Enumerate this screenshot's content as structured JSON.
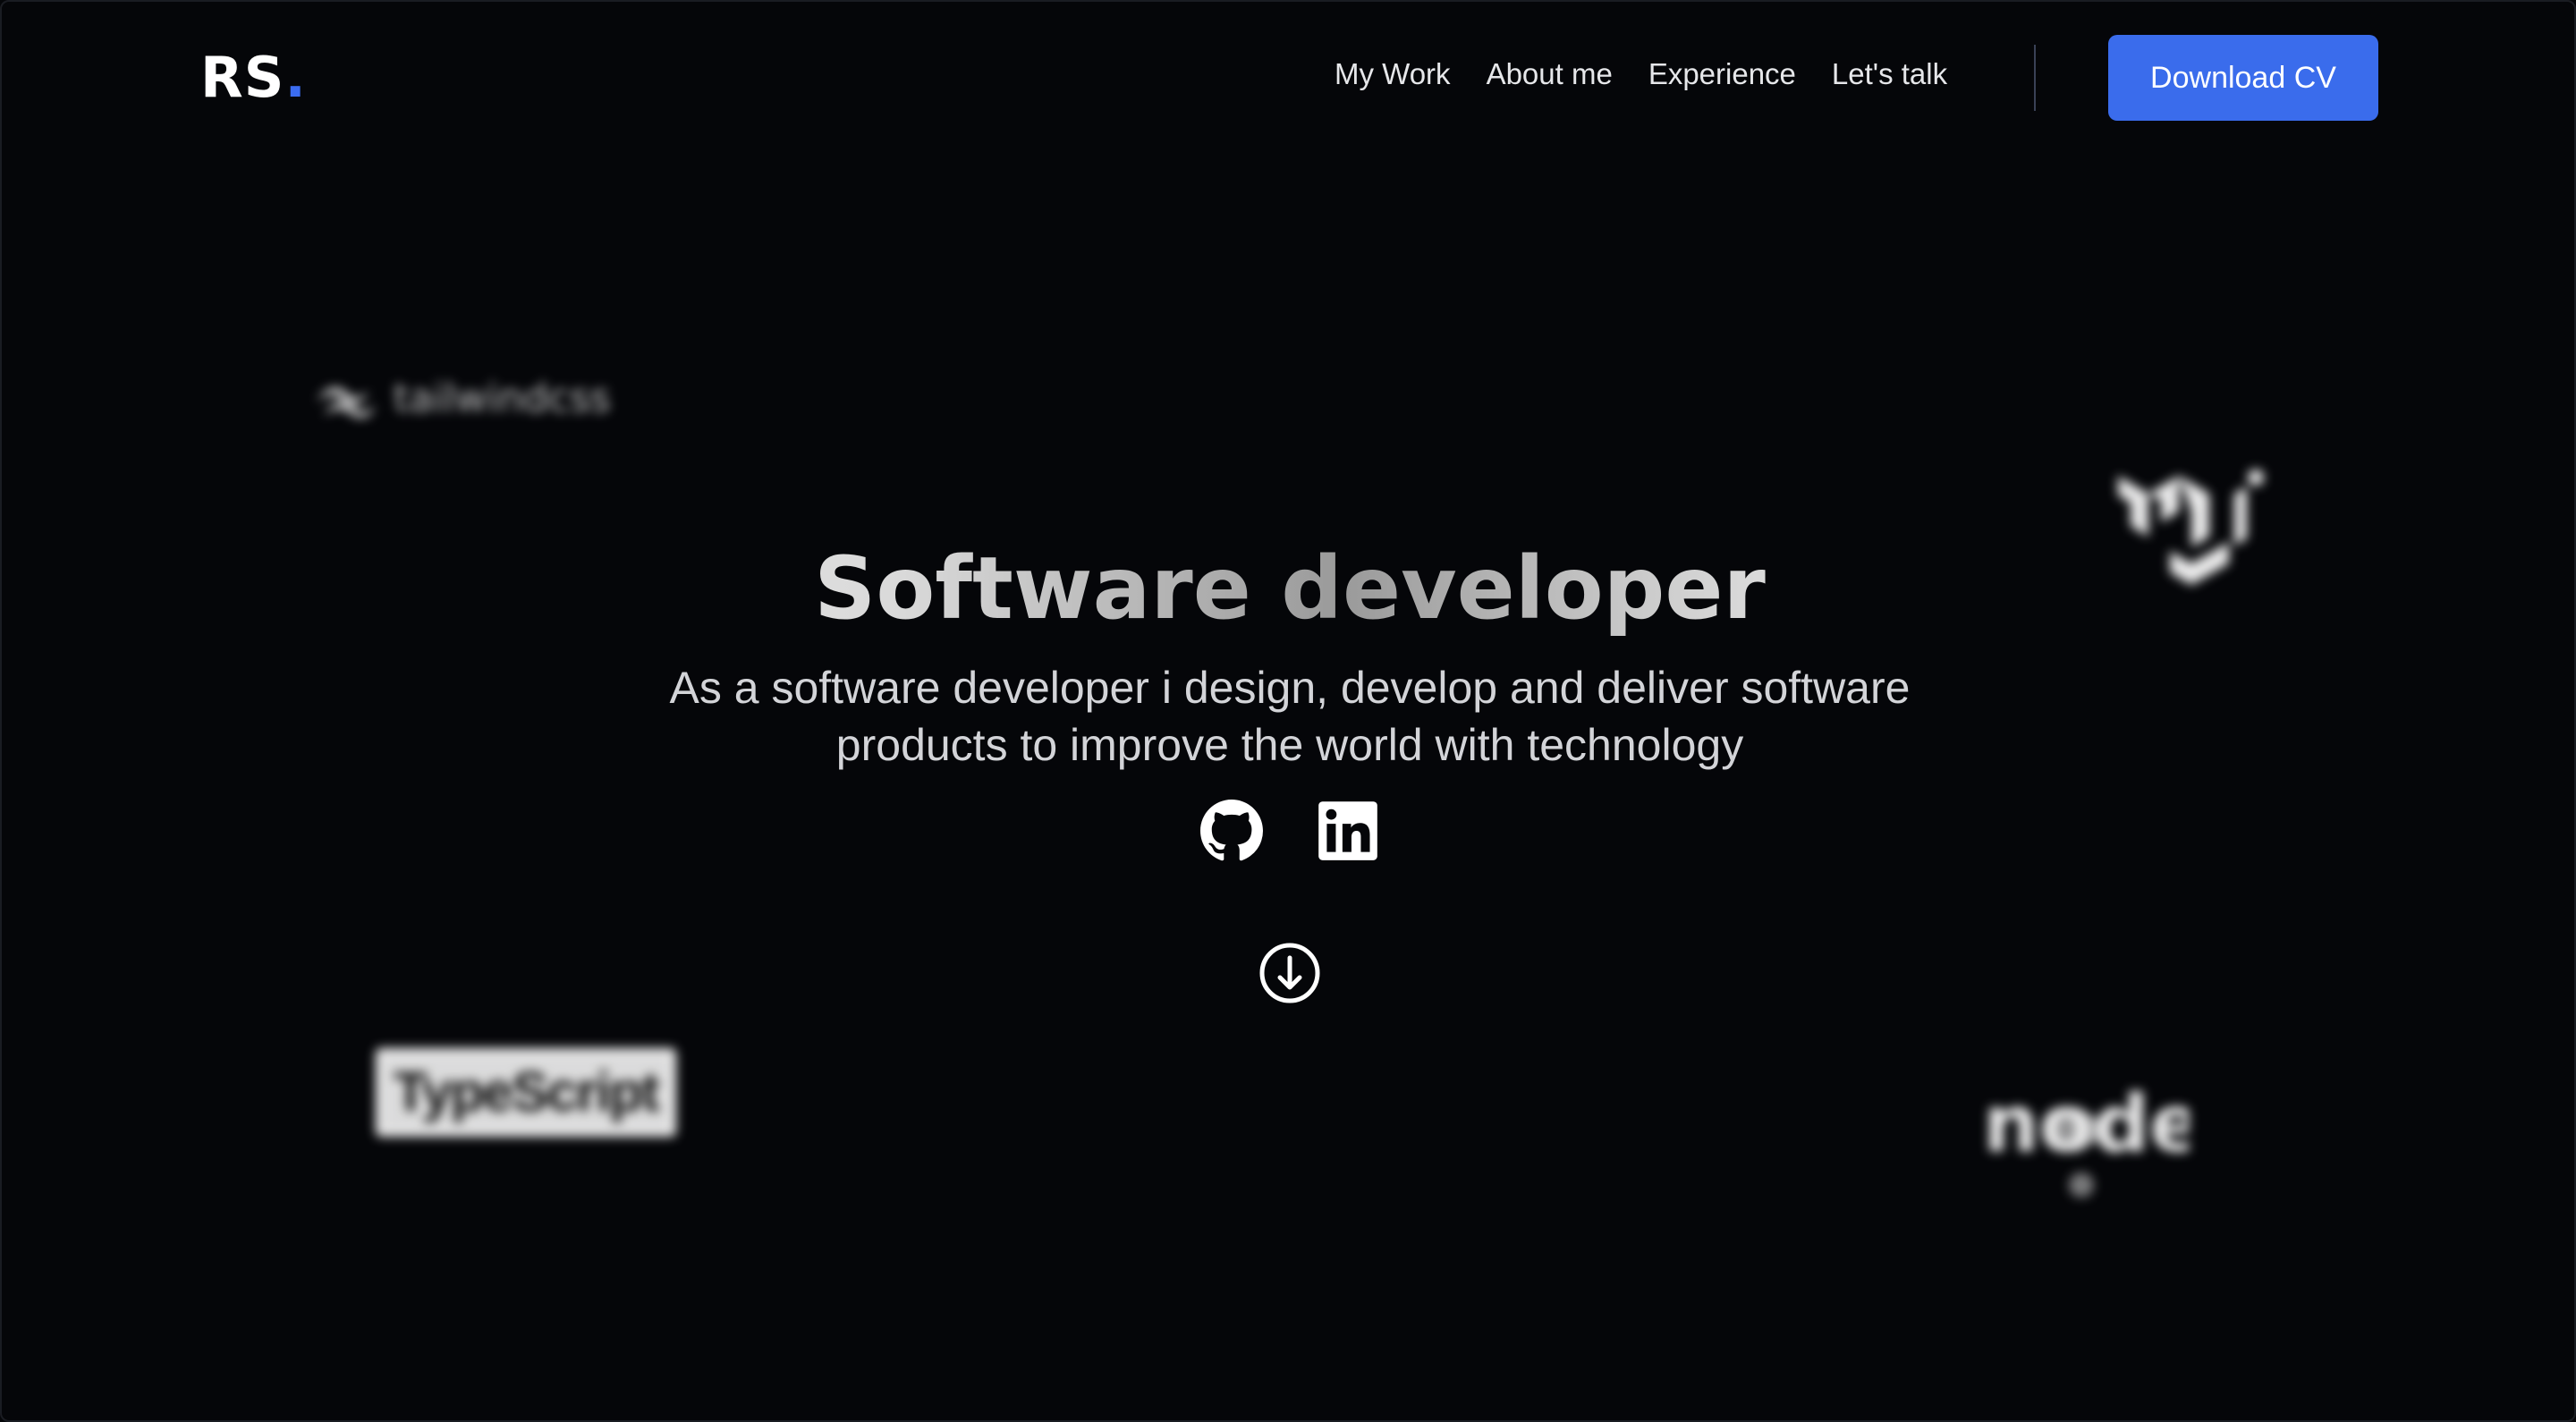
{
  "header": {
    "logo_text": "RS",
    "logo_dot": ".",
    "nav": [
      "My Work",
      "About me",
      "Experience",
      "Let's talk"
    ],
    "cv_button": "Download CV"
  },
  "hero": {
    "title": "Software developer",
    "subtitle_line1": "As a software developer i design, develop and deliver software",
    "subtitle_line2": "products to improve the world with technology"
  },
  "tech_logos": {
    "tailwind": "tailwindcss",
    "mui": "MUI",
    "typescript": "TypeScript",
    "node": "node"
  },
  "icons": {
    "github": "github-icon",
    "linkedin": "linkedin-icon",
    "scroll": "arrow-down-circle-icon"
  },
  "colors": {
    "background": "#050609",
    "accent": "#3a6cec",
    "text": "#e8e9ec"
  }
}
